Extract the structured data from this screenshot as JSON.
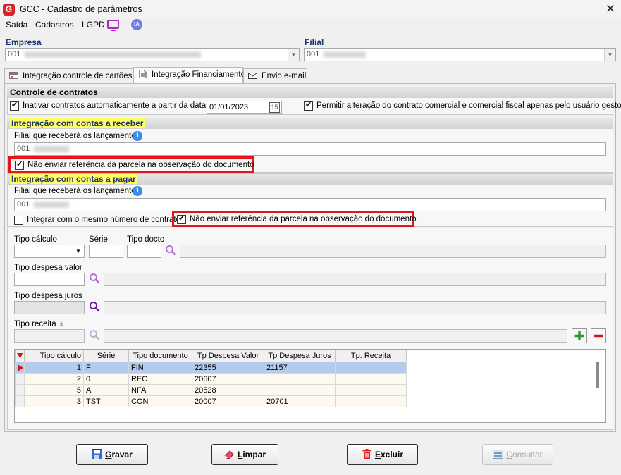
{
  "window": {
    "title": "GCC - Cadastro de parâmetros",
    "logo_letter": "G",
    "close_glyph": "✕"
  },
  "menu": {
    "items": [
      "Saída",
      "Cadastros",
      "LGPD"
    ],
    "ia_label": "IA"
  },
  "empresa": {
    "label": "Empresa",
    "value": "001"
  },
  "filial": {
    "label": "Filial",
    "value": "001"
  },
  "tabs": [
    {
      "label": "Integração controle de cartões"
    },
    {
      "label": "Integração Financiamento"
    },
    {
      "label": "Envio e-mail"
    }
  ],
  "controle": {
    "header": "Controle de contratos",
    "inativar_label": "Inativar contratos automaticamente a partir da data:",
    "inativar_checked": true,
    "date_value": "01/01/2023",
    "date_button": "15",
    "permitir_label": "Permitir alteração do contrato comercial e comercial fiscal apenas pelo usuário gestor",
    "permitir_checked": true
  },
  "receber": {
    "header": "Integração com contas a receber",
    "filial_label": "Filial que receberá os lançamentos",
    "filial_value": "001",
    "nao_enviar_label": "Não enviar referência da parcela na observação do documento",
    "nao_enviar_checked": true
  },
  "pagar": {
    "header": "Integração com contas a pagar",
    "filial_label": "Filial que receberá os lançamentos",
    "filial_value": "001",
    "integrar_label": "Integrar com o mesmo número de contrato",
    "integrar_checked": false,
    "nao_enviar_label": "Não enviar referência da parcela na observação do documento",
    "nao_enviar_checked": true
  },
  "params": {
    "tipo_calculo_label": "Tipo cálculo",
    "serie_label": "Série",
    "tipo_docto_label": "Tipo docto",
    "tipo_despesa_valor_label": "Tipo despesa valor",
    "tipo_despesa_juros_label": "Tipo despesa juros",
    "tipo_receita_label": "Tipo receita",
    "receita_marker": "↡"
  },
  "grid": {
    "columns": [
      "Tipo cálculo",
      "Série",
      "Tipo documento",
      "Tp Despesa Valor",
      "Tp Despesa Juros",
      "Tp. Receita"
    ],
    "rows": [
      [
        "1",
        "F",
        "FIN",
        "22355",
        "21157",
        ""
      ],
      [
        "2",
        "0",
        "REC",
        "20607",
        "",
        ""
      ],
      [
        "5",
        "A",
        "NFA",
        "20528",
        "",
        ""
      ],
      [
        "3",
        "TST",
        "CON",
        "20007",
        "20701",
        ""
      ]
    ],
    "selected_row": 0
  },
  "buttons": {
    "gravar": {
      "first": "G",
      "rest": "ravar"
    },
    "limpar": {
      "first": "L",
      "rest": "impar"
    },
    "excluir": {
      "first": "E",
      "rest": "xcluir"
    },
    "consultar": {
      "first": "C",
      "rest": "onsultar"
    }
  },
  "colors": {
    "highlight_red": "#e2161b",
    "section_yellow": "#ffff66",
    "brand": "#d7262b"
  }
}
